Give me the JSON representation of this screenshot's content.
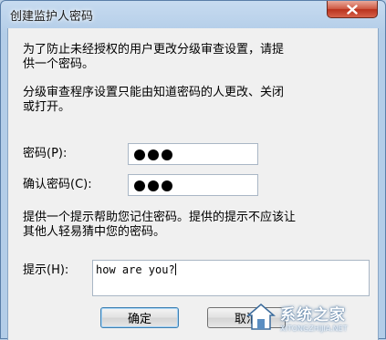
{
  "window": {
    "title": "创建监护人密码"
  },
  "intro": {
    "line1": "为了防止未经授权的用户更改分级审查设置，请提供一个密码。"
  },
  "notice": {
    "text": "分级审查程序设置只能由知道密码的人更改、关闭或打开。"
  },
  "password": {
    "label": "密码(P):",
    "mask_length": 3
  },
  "confirm": {
    "label": "确认密码(C):",
    "mask_length": 3
  },
  "hint_info": {
    "text": "提供一个提示帮助您记住密码。提供的提示不应该让其他人轻易猜中您的密码。"
  },
  "hint": {
    "label": "提示(H):",
    "value": "how are you?"
  },
  "buttons": {
    "ok": "确定",
    "cancel": "取消"
  },
  "watermark": {
    "text": "系统之家",
    "url": "XITONGZHIJIA.NET"
  },
  "colors": {
    "titlebar": "#b3cde8",
    "client": "#f0f0f0",
    "close": "#cf5a44"
  }
}
